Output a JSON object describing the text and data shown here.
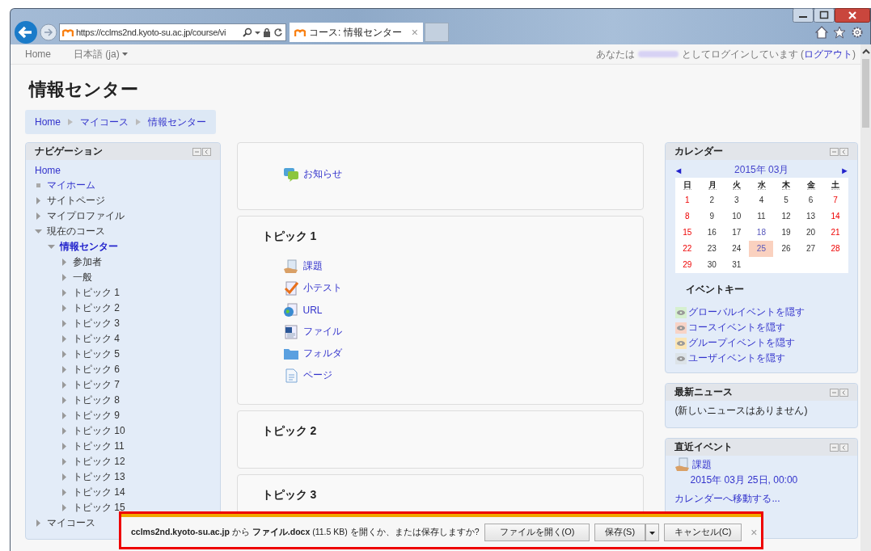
{
  "browser": {
    "address": "https://cclms2nd.kyoto-su.ac.jp/course/vi",
    "tab": {
      "title": "コース: 情報センター",
      "close": "×"
    }
  },
  "topbar": {
    "home": "Home",
    "language": "日本語 (ja)",
    "login_before": "あなたは",
    "login_after": "としてログインしています (",
    "logout": "ログアウト",
    "login_end": ")"
  },
  "heading": "情報センター",
  "breadcrumb": [
    "Home",
    "マイコース",
    "情報センター"
  ],
  "navigation": {
    "title": "ナビゲーション",
    "items": [
      {
        "label": "Home",
        "kind": "link"
      },
      {
        "label": "マイホーム",
        "kind": "leaf"
      },
      {
        "label": "サイトページ",
        "kind": "branch",
        "expanded": false
      },
      {
        "label": "マイプロファイル",
        "kind": "branch",
        "expanded": false
      },
      {
        "label": "現在のコース",
        "kind": "branch",
        "expanded": true,
        "children": [
          {
            "label": "情報センター",
            "kind": "current",
            "expanded": true,
            "children": [
              {
                "label": "参加者",
                "kind": "branch",
                "expanded": false
              },
              {
                "label": "一般",
                "kind": "branch",
                "expanded": false
              },
              {
                "label": "トピック 1",
                "kind": "branch",
                "expanded": false
              },
              {
                "label": "トピック 2",
                "kind": "branch",
                "expanded": false
              },
              {
                "label": "トピック 3",
                "kind": "branch",
                "expanded": false
              },
              {
                "label": "トピック 4",
                "kind": "branch",
                "expanded": false
              },
              {
                "label": "トピック 5",
                "kind": "branch",
                "expanded": false
              },
              {
                "label": "トピック 6",
                "kind": "branch",
                "expanded": false
              },
              {
                "label": "トピック 7",
                "kind": "branch",
                "expanded": false
              },
              {
                "label": "トピック 8",
                "kind": "branch",
                "expanded": false
              },
              {
                "label": "トピック 9",
                "kind": "branch",
                "expanded": false
              },
              {
                "label": "トピック 10",
                "kind": "branch",
                "expanded": false
              },
              {
                "label": "トピック 11",
                "kind": "branch",
                "expanded": false
              },
              {
                "label": "トピック 12",
                "kind": "branch",
                "expanded": false
              },
              {
                "label": "トピック 13",
                "kind": "branch",
                "expanded": false
              },
              {
                "label": "トピック 14",
                "kind": "branch",
                "expanded": false
              },
              {
                "label": "トピック 15",
                "kind": "branch",
                "expanded": false
              }
            ]
          }
        ]
      },
      {
        "label": "マイコース",
        "kind": "branch",
        "expanded": false
      }
    ]
  },
  "sections": [
    {
      "activities": [
        {
          "label": "お知らせ",
          "kind": "forum"
        }
      ]
    },
    {
      "title": "トピック 1",
      "activities": [
        {
          "label": "課題",
          "kind": "assignment"
        },
        {
          "label": "小テスト",
          "kind": "quiz"
        },
        {
          "label": "URL",
          "kind": "url"
        },
        {
          "label": "ファイル",
          "kind": "file"
        },
        {
          "label": "フォルダ",
          "kind": "folder"
        },
        {
          "label": "ページ",
          "kind": "page"
        }
      ]
    },
    {
      "title": "トピック 2"
    },
    {
      "title": "トピック 3"
    }
  ],
  "calendar": {
    "title": "カレンダー",
    "prev": "◄",
    "month": "2015年 03月",
    "next": "►",
    "weekdays": [
      "日",
      "月",
      "火",
      "水",
      "木",
      "金",
      "土"
    ],
    "weeks": [
      [
        {
          "d": "1",
          "kind": "weekend"
        },
        {
          "d": "2",
          "kind": "weekday"
        },
        {
          "d": "3",
          "kind": "weekday"
        },
        {
          "d": "4",
          "kind": "weekday"
        },
        {
          "d": "5",
          "kind": "weekday"
        },
        {
          "d": "6",
          "kind": "weekday"
        },
        {
          "d": "7",
          "kind": "weekend"
        }
      ],
      [
        {
          "d": "8",
          "kind": "weekend"
        },
        {
          "d": "9",
          "kind": "weekday"
        },
        {
          "d": "10",
          "kind": "weekday"
        },
        {
          "d": "11",
          "kind": "weekday"
        },
        {
          "d": "12",
          "kind": "weekday"
        },
        {
          "d": "13",
          "kind": "weekday"
        },
        {
          "d": "14",
          "kind": "weekend"
        }
      ],
      [
        {
          "d": "15",
          "kind": "weekend"
        },
        {
          "d": "16",
          "kind": "weekday"
        },
        {
          "d": "17",
          "kind": "weekday"
        },
        {
          "d": "18",
          "kind": "event"
        },
        {
          "d": "19",
          "kind": "weekday"
        },
        {
          "d": "20",
          "kind": "weekday"
        },
        {
          "d": "21",
          "kind": "weekend"
        }
      ],
      [
        {
          "d": "22",
          "kind": "weekend"
        },
        {
          "d": "23",
          "kind": "weekday"
        },
        {
          "d": "24",
          "kind": "weekday"
        },
        {
          "d": "25",
          "kind": "today"
        },
        {
          "d": "26",
          "kind": "weekday"
        },
        {
          "d": "27",
          "kind": "weekday"
        },
        {
          "d": "28",
          "kind": "weekend"
        }
      ],
      [
        {
          "d": "29",
          "kind": "weekend"
        },
        {
          "d": "30",
          "kind": "weekday"
        },
        {
          "d": "31",
          "kind": "weekday"
        }
      ]
    ],
    "event_key_title": "イベントキー",
    "event_key": [
      {
        "label": "グローバルイベントを隠す",
        "color": "#d6f0cf"
      },
      {
        "label": "コースイベントを隠す",
        "color": "#f8d3c6"
      },
      {
        "label": "グループイベントを隠す",
        "color": "#fbe5b3"
      },
      {
        "label": "ユーザイベントを隠す",
        "color": "#dce3e8"
      }
    ]
  },
  "news": {
    "title": "最新ニュース",
    "text": "(新しいニュースはありません)"
  },
  "upcoming": {
    "title": "直近イベント",
    "event": "課題",
    "date": "2015年 03月 25日, 00:00",
    "link": "カレンダーへ移動する..."
  },
  "download_bar": {
    "message": "**cclms2nd.kyoto-su.ac.jp** から **ファイル.docx** (11.5 KB) を開くか、または保存しますか?",
    "open": "ファイルを開く(O)",
    "save": "保存(S)",
    "cancel": "キャンセル(C)",
    "close": "×"
  }
}
